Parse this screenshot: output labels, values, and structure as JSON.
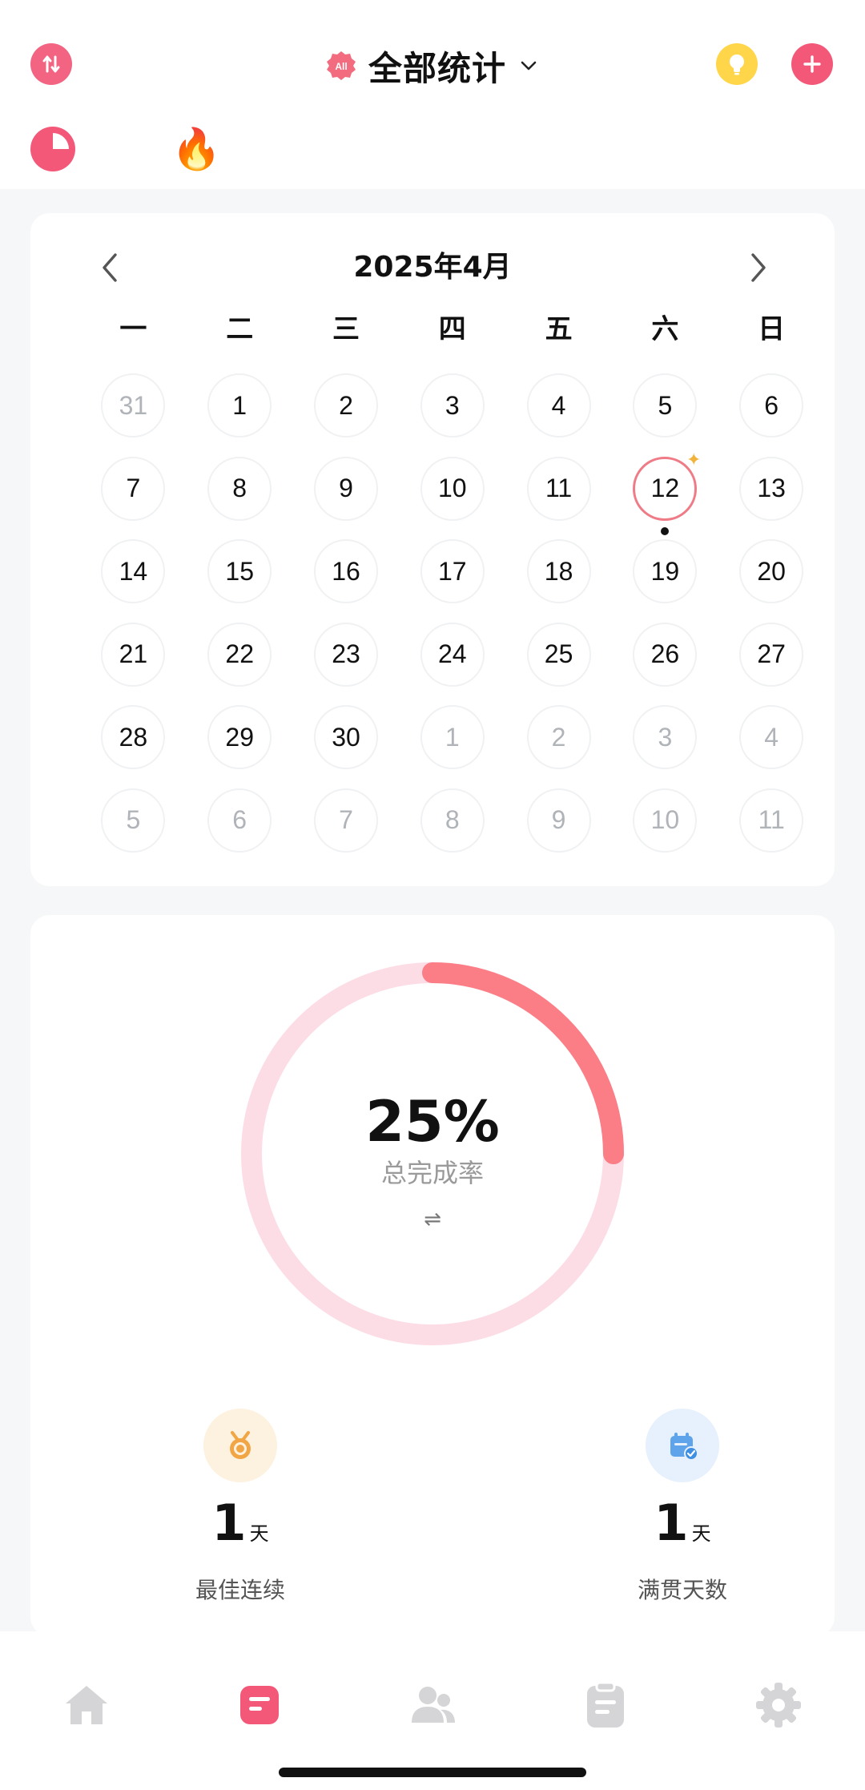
{
  "header": {
    "title": "全部统计",
    "all_badge": "All",
    "icons": {
      "sort": "sort-arrows-icon",
      "title_dropdown": "chevron-down-icon",
      "bulb": "lightbulb-icon",
      "add": "plus-icon"
    },
    "tabs": [
      {
        "icon": "pie-chart-icon",
        "active": true
      },
      {
        "icon": "fire-icon",
        "glyph": "🔥",
        "active": false
      }
    ]
  },
  "calendar": {
    "month_title": "2025年4月",
    "weekdays": [
      "一",
      "二",
      "三",
      "四",
      "五",
      "六",
      "日"
    ],
    "days": [
      {
        "d": "31",
        "muted": true
      },
      {
        "d": "1"
      },
      {
        "d": "2"
      },
      {
        "d": "3"
      },
      {
        "d": "4"
      },
      {
        "d": "5"
      },
      {
        "d": "6"
      },
      {
        "d": "7"
      },
      {
        "d": "8"
      },
      {
        "d": "9"
      },
      {
        "d": "10"
      },
      {
        "d": "11"
      },
      {
        "d": "12",
        "today": true
      },
      {
        "d": "13"
      },
      {
        "d": "14"
      },
      {
        "d": "15"
      },
      {
        "d": "16"
      },
      {
        "d": "17"
      },
      {
        "d": "18"
      },
      {
        "d": "19"
      },
      {
        "d": "20"
      },
      {
        "d": "21"
      },
      {
        "d": "22"
      },
      {
        "d": "23"
      },
      {
        "d": "24"
      },
      {
        "d": "25"
      },
      {
        "d": "26"
      },
      {
        "d": "27"
      },
      {
        "d": "28"
      },
      {
        "d": "29"
      },
      {
        "d": "30"
      },
      {
        "d": "1",
        "muted": true
      },
      {
        "d": "2",
        "muted": true
      },
      {
        "d": "3",
        "muted": true
      },
      {
        "d": "4",
        "muted": true
      },
      {
        "d": "5",
        "muted": true
      },
      {
        "d": "6",
        "muted": true
      },
      {
        "d": "7",
        "muted": true
      },
      {
        "d": "8",
        "muted": true
      },
      {
        "d": "9",
        "muted": true
      },
      {
        "d": "10",
        "muted": true
      },
      {
        "d": "11",
        "muted": true
      }
    ]
  },
  "completion": {
    "percent_text": "25%",
    "fraction": 0.25,
    "label": "总完成率",
    "swap_glyph": "⇌",
    "colors": {
      "track": "#fddde5",
      "progress": "#fb7d86"
    }
  },
  "stats": [
    {
      "icon": "medal-icon",
      "value": "1",
      "unit": "天",
      "label": "最佳连续"
    },
    {
      "icon": "calendar-check-icon",
      "value": "1",
      "unit": "天",
      "label": "满贯天数"
    }
  ],
  "bottom_nav": [
    {
      "name": "home",
      "icon": "home-icon",
      "active": false
    },
    {
      "name": "stats",
      "icon": "stats-note-icon",
      "active": true
    },
    {
      "name": "friends",
      "icon": "users-icon",
      "active": false
    },
    {
      "name": "tasks",
      "icon": "clipboard-icon",
      "active": false
    },
    {
      "name": "settings",
      "icon": "gear-icon",
      "active": false
    }
  ],
  "colors": {
    "accent": "#f45878",
    "inactive_nav": "#d5d5d7",
    "page_bg": "#f6f7f9"
  }
}
